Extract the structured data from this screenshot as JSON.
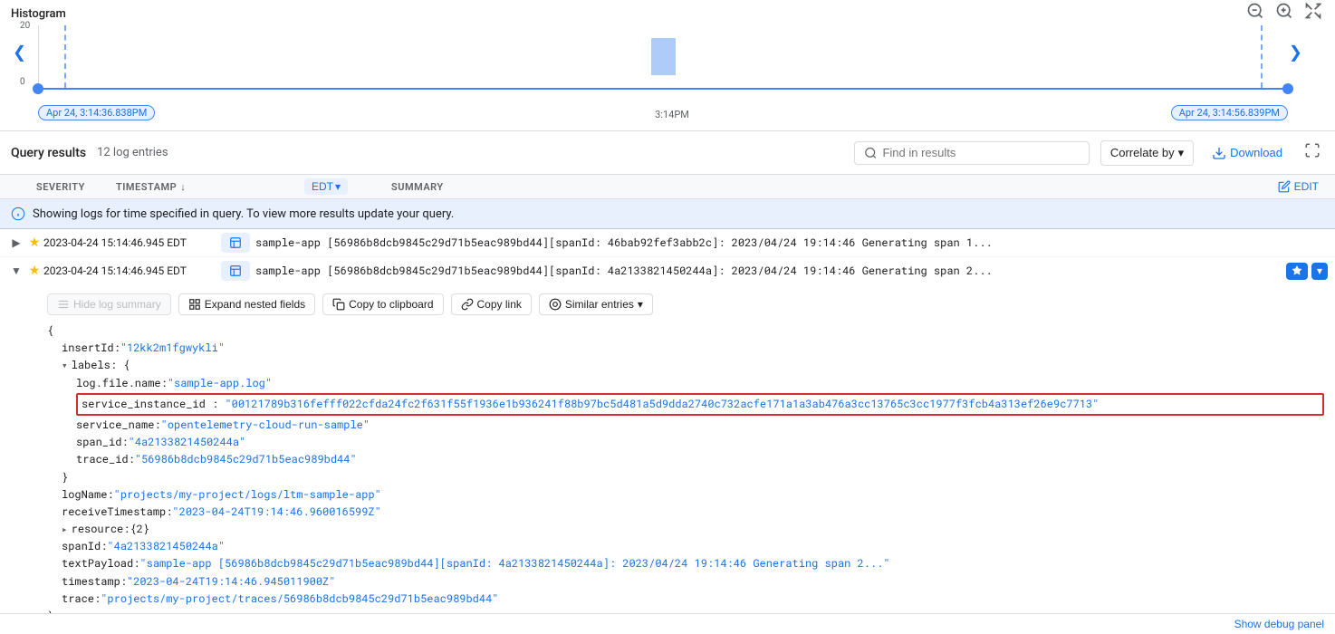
{
  "histogram": {
    "title": "Histogram",
    "y_max": "20",
    "y_min": "0",
    "time_left": "Apr 24, 3:14:36.838PM",
    "time_mid": "3:14PM",
    "time_right": "Apr 24, 3:14:56.839PM"
  },
  "query_results": {
    "title": "Query results",
    "count": "12 log entries",
    "find_placeholder": "Find in results",
    "correlate_label": "Correlate by",
    "download_label": "Download"
  },
  "table_header": {
    "severity": "SEVERITY",
    "timestamp": "TIMESTAMP",
    "edt_label": "EDT",
    "summary_label": "SUMMARY",
    "edit_label": "EDIT"
  },
  "info_banner": {
    "text": "Showing logs for time specified in query. To view more results update your query."
  },
  "log_rows": [
    {
      "timestamp": "2023-04-24 15:14:46.945 EDT",
      "text": "sample-app [56986b8dcb9845c29d71b5eac989bd44][spanId: 46bab92fef3abb2c]: 2023/04/24 19:14:46 Generating span 1...",
      "expanded": false
    },
    {
      "timestamp": "2023-04-24 15:14:46.945 EDT",
      "text": "sample-app [56986b8dcb9845c29d71b5eac989bd44][spanId: 4a2133821450244a]: 2023/04/24 19:14:46 Generating span 2...",
      "expanded": true
    }
  ],
  "log_detail": {
    "actions": {
      "hide_log_summary": "Hide log summary",
      "expand_nested": "Expand nested fields",
      "copy_to_clipboard": "Copy to clipboard",
      "copy_link": "Copy link",
      "similar_entries": "Similar entries"
    },
    "json": {
      "insertId": "\"12kk2m1fgwykli\"",
      "labels_key": "labels",
      "log_file_name_key": "log.file.name",
      "log_file_name_val": "\"sample-app.log\"",
      "service_instance_id_key": "service_instance_id",
      "service_instance_id_val": "\"00121789b316fefff022cfda24fc2f631f55f1936e1b936241f88b97bc5d481a5d9dda2740c732acfe171a1a3ab476a3cc13765c3cc1977f3fcb4a313ef26e9c7713\"",
      "service_name_key": "service_name",
      "service_name_val": "\"opentelemetry-cloud-run-sample\"",
      "span_id_key": "span_id",
      "span_id_val": "\"4a2133821450244a\"",
      "trace_id_key": "trace_id",
      "trace_id_val": "\"56986b8dcb9845c29d71b5eac989bd44\"",
      "logName_key": "logName",
      "logName_val": "\"projects/my-project/logs/ltm-sample-app\"",
      "receiveTimestamp_key": "receiveTimestamp",
      "receiveTimestamp_val": "\"2023-04-24T19:14:46.960016599Z\"",
      "resource_key": "resource",
      "resource_val": "{2}",
      "spanId_key": "spanId",
      "spanId_val": "\"4a2133821450244a\"",
      "textPayload_key": "textPayload",
      "textPayload_val": "\"sample-app [56986b8dcb9845c29d71b5eac989bd44][spanId: 4a2133821450244a]: 2023/04/24 19:14:46 Generating span 2...\"",
      "timestamp_key": "timestamp",
      "timestamp_val": "\"2023-04-24T19:14:46.945011900Z\"",
      "trace_key": "trace",
      "trace_val": "\"projects/my-project/traces/56986b8dcb9845c29d71b5eac989bd44\""
    }
  },
  "icons": {
    "zoom_in": "🔍",
    "zoom_out": "🔎",
    "expand": "⊞",
    "chevron_down": "▾",
    "chevron_right": "▸",
    "search": "🔍",
    "download": "⬇",
    "fullscreen": "⛶",
    "edit_pencil": "✏",
    "info": "ℹ",
    "pin": "📌",
    "copy": "⧉",
    "link": "🔗",
    "similar": "◎",
    "expand_nested": "⊞",
    "hide_summary": "≡"
  },
  "colors": {
    "blue": "#1a73e8",
    "light_blue_bg": "#e8f0fe",
    "border": "#dadce0",
    "text_primary": "#202124",
    "text_secondary": "#5f6368",
    "highlight_red": "#d32f2f",
    "warning_yellow": "#fbbc04"
  }
}
